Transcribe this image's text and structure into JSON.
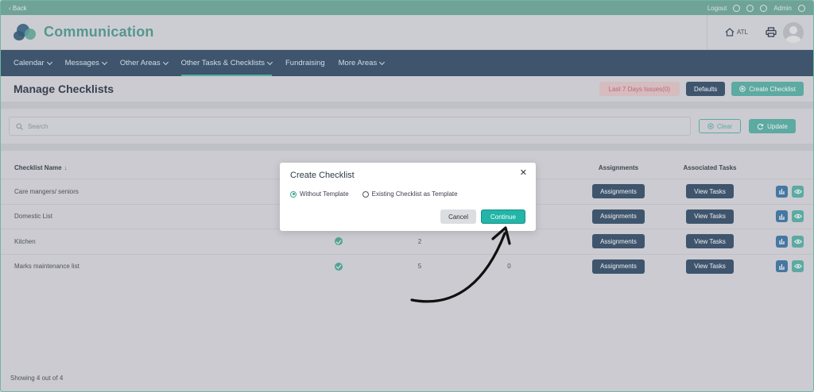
{
  "topbar": {
    "back": "‹ Back",
    "logout": "Logout",
    "user": "Admin"
  },
  "header": {
    "app_title": "Communication",
    "home_label": "ATL"
  },
  "nav": {
    "items": [
      {
        "label": "Calendar",
        "dropdown": true
      },
      {
        "label": "Messages",
        "dropdown": true
      },
      {
        "label": "Other Areas",
        "dropdown": true
      },
      {
        "label": "Other Tasks & Checklists",
        "dropdown": true,
        "active": true
      },
      {
        "label": "Fundraising",
        "dropdown": false
      },
      {
        "label": "More Areas",
        "dropdown": true
      }
    ]
  },
  "page": {
    "title": "Manage Checklists",
    "issues_button": "Last 7 Days Issues(0)",
    "defaults_button": "Defaults",
    "create_button": "Create Checklist"
  },
  "search": {
    "placeholder": "Search",
    "clear": "Clear",
    "update": "Update"
  },
  "table": {
    "headers": {
      "name": "Checklist Name",
      "assignments": "Assignments",
      "tasks": "Associated Tasks"
    },
    "rows": [
      {
        "name": "Care mangers/ seniors",
        "active": false,
        "items": "",
        "issues": "",
        "assign_btn": "Assignments",
        "tasks_btn": "View Tasks"
      },
      {
        "name": "Domestic List",
        "active": false,
        "items": "",
        "issues": "",
        "assign_btn": "Assignments",
        "tasks_btn": "View Tasks"
      },
      {
        "name": "Kitchen",
        "active": true,
        "items": "2",
        "issues": "",
        "assign_btn": "Assignments",
        "tasks_btn": "View Tasks"
      },
      {
        "name": "Marks maintenance list",
        "active": true,
        "items": "5",
        "issues": "0",
        "assign_btn": "Assignments",
        "tasks_btn": "View Tasks"
      }
    ]
  },
  "footer": {
    "showing": "Showing 4 out of 4"
  },
  "modal": {
    "title": "Create Checklist",
    "option_1": "Without Template",
    "option_2": "Existing Checklist as Template",
    "selected_option": "Without Template",
    "cancel": "Cancel",
    "continue": "Continue"
  },
  "colors": {
    "nav_bg": "#36506a",
    "accent": "#58b1a5",
    "brand": "#4f9b8f",
    "continue": "#22b5a8"
  }
}
